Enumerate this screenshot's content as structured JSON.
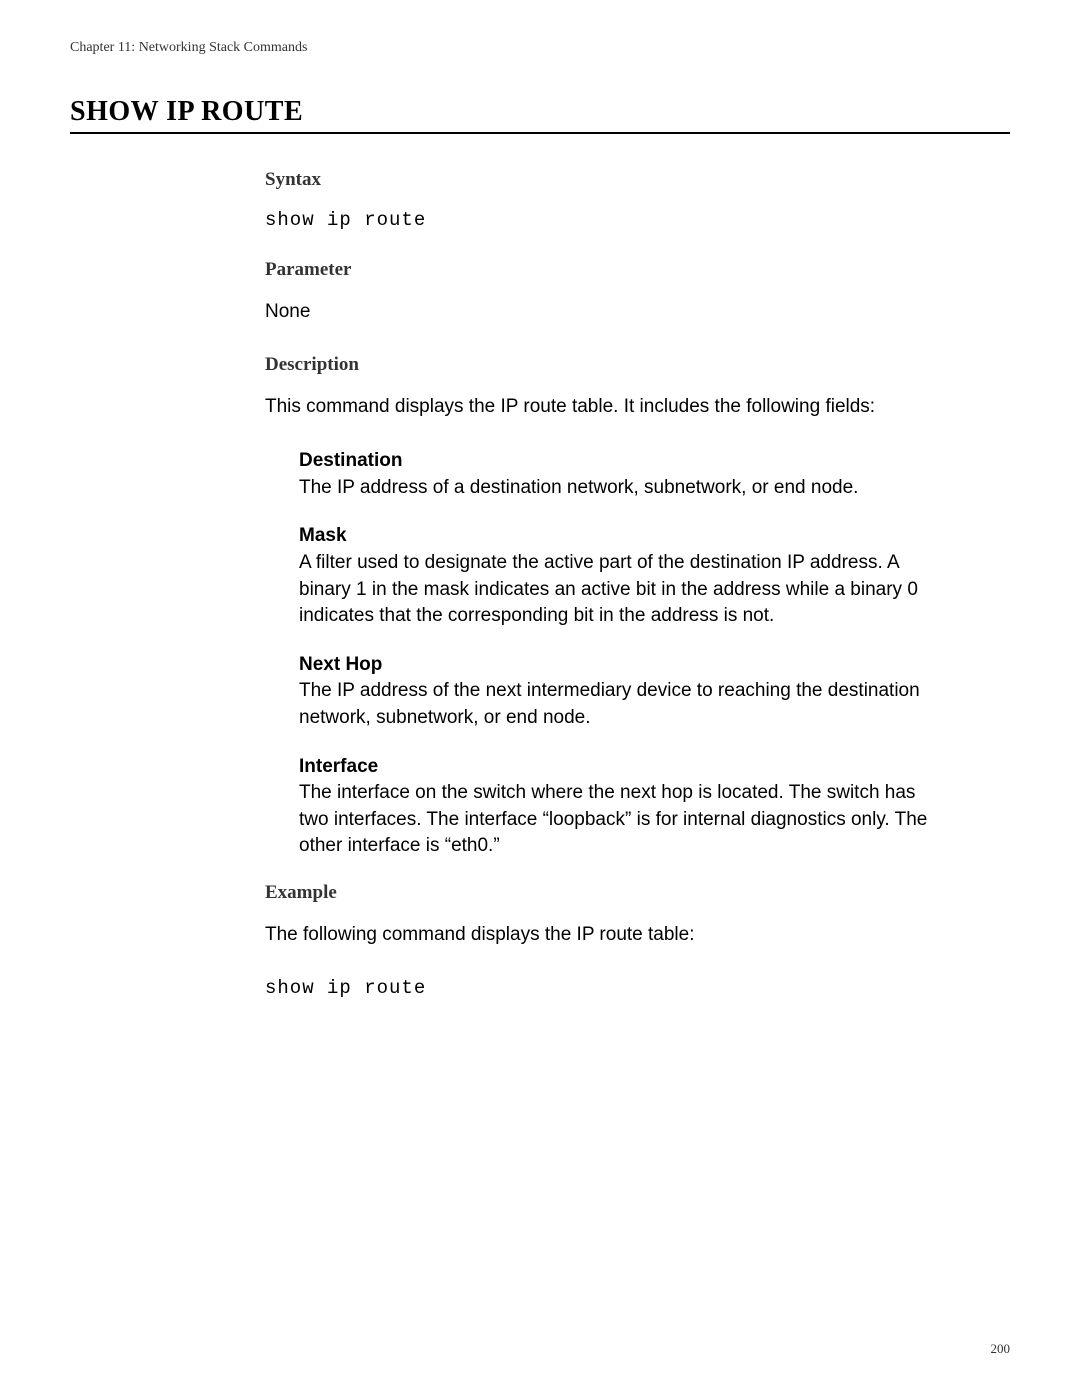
{
  "header": {
    "chapter": "Chapter 11: Networking Stack Commands"
  },
  "title": "SHOW IP ROUTE",
  "sections": {
    "syntax": {
      "heading": "Syntax",
      "code": "show ip route"
    },
    "parameter": {
      "heading": "Parameter",
      "text": "None"
    },
    "description": {
      "heading": "Description",
      "intro": "This command displays the IP route table. It includes the following fields:",
      "fields": [
        {
          "label": "Destination",
          "desc": "The IP address of a destination network, subnetwork, or end node."
        },
        {
          "label": "Mask",
          "desc": "A filter used to designate the active part of the destination IP address. A binary 1 in the mask indicates an active bit in the address while a binary 0 indicates that the corresponding bit in the address is not."
        },
        {
          "label": "Next Hop",
          "desc": "The IP address of the next intermediary device to reaching the destination network, subnetwork, or end node."
        },
        {
          "label": "Interface",
          "desc": "The interface on the switch where the next hop is located. The switch has two interfaces. The interface “loopback” is for internal diagnostics only. The other interface is “eth0.”"
        }
      ]
    },
    "example": {
      "heading": "Example",
      "text": "The following command displays the IP route table:",
      "code": "show ip route"
    }
  },
  "footer": {
    "page": "200"
  }
}
